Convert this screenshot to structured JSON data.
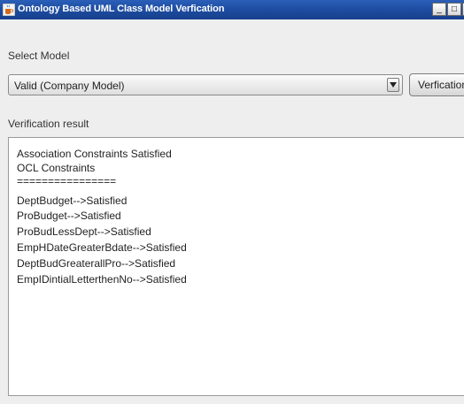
{
  "window": {
    "title": "Ontology Based UML Class Model Verfication",
    "buttons": [
      "_",
      "□",
      "×"
    ]
  },
  "select_model": {
    "label": "Select Model",
    "selected_value": "Valid (Company Model)"
  },
  "verify_button": {
    "label": "Verfication"
  },
  "result": {
    "label": "Verification result",
    "lines": [
      "Association Constraints Satisfied",
      "OCL Constraints",
      "================",
      "DeptBudget-->Satisfied",
      "ProBudget-->Satisfied",
      "ProBudLessDept-->Satisfied",
      "EmpHDateGreaterBdate-->Satisfied",
      "DeptBudGreaterallPro-->Satisfied",
      "EmpIDintialLetterthenNo-->Satisfied"
    ]
  },
  "icons": {
    "app": "java-coffee-icon",
    "dropdown": "chevron-down-icon"
  }
}
